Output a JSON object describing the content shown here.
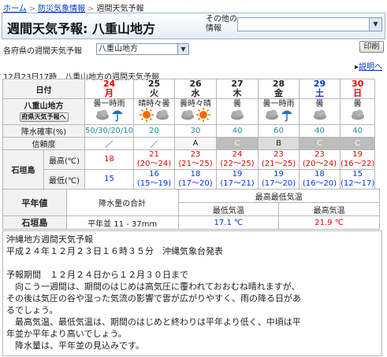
{
  "breadcrumb": [
    "ホーム",
    "防災気象情報",
    "週間天気予報"
  ],
  "header": {
    "title": "週間天気予報: 八重山地方",
    "other_info_label": "その他の情報",
    "other_info_value": ""
  },
  "toolbar": {
    "pref_label": "各府県の週間天気予報",
    "pref_value": "八重山地方",
    "print_label": "印刷",
    "help_label": "説明へ"
  },
  "issue_line": "12月23日17時　八重山地方の週間天気予報",
  "forecast": {
    "row_labels": {
      "date": "日付",
      "region": "八重山地方",
      "region_button": "府県天気予報へ",
      "pop": "降水確率(%)",
      "reliability": "信頼度",
      "city": "石垣島",
      "max": "最高(℃)",
      "min": "最低(℃)"
    },
    "days": [
      {
        "date": "24",
        "dow": "月",
        "weather": "曇一時雨",
        "icons": [
          "cloud-icon",
          "umbrella-icon"
        ],
        "pop": "50/30/20/10",
        "rel": "／",
        "max": "18",
        "max_range": "",
        "min": "15",
        "min_range": "",
        "color": "red"
      },
      {
        "date": "25",
        "dow": "火",
        "weather": "晴時々曇",
        "icons": [
          "sun-icon",
          "cloud-icon"
        ],
        "pop": "20",
        "rel": "／",
        "max": "21",
        "max_range": "(20〜24)",
        "min": "16",
        "min_range": "(15〜19)",
        "color": ""
      },
      {
        "date": "26",
        "dow": "水",
        "weather": "曇時々晴",
        "icons": [
          "cloud-icon",
          "sun-icon"
        ],
        "pop": "30",
        "rel": "A",
        "max": "23",
        "max_range": "(21〜25)",
        "min": "18",
        "min_range": "(17〜20)",
        "color": ""
      },
      {
        "date": "27",
        "dow": "木",
        "weather": "曇",
        "icons": [
          "cloud-icon"
        ],
        "pop": "40",
        "rel": "C",
        "max": "24",
        "max_range": "(22〜25)",
        "min": "19",
        "min_range": "(17〜21)",
        "color": ""
      },
      {
        "date": "28",
        "dow": "金",
        "weather": "曇一時雨",
        "icons": [
          "cloud-icon",
          "umbrella-icon"
        ],
        "pop": "60",
        "rel": "B",
        "max": "23",
        "max_range": "(21〜25)",
        "min": "19",
        "min_range": "(17〜20)",
        "color": ""
      },
      {
        "date": "29",
        "dow": "土",
        "weather": "曇",
        "icons": [
          "cloud-icon"
        ],
        "pop": "40",
        "rel": "C",
        "max": "23",
        "max_range": "(20〜24)",
        "min": "18",
        "min_range": "(16〜20)",
        "color": "blue"
      },
      {
        "date": "30",
        "dow": "日",
        "weather": "曇",
        "icons": [
          "cloud-icon"
        ],
        "pop": "40",
        "rel": "C",
        "max": "19",
        "max_range": "(16〜22)",
        "min": "15",
        "min_range": "(12〜17)",
        "color": "red"
      }
    ]
  },
  "normals": {
    "title": "平年値",
    "precip_header": "降水量の合計",
    "temp_header": "最高最低気温",
    "min_header": "最低気温",
    "max_header": "最高気温",
    "city": "石垣島",
    "precip_value": "平年並 11 - 37mm",
    "min_value": "17.1 ℃",
    "max_value": "21.9 ℃"
  },
  "text": {
    "body": "沖縄地方週間天気予報\n平成２４年１２月２３日１６時３５分　沖縄気象台発表\n\n予報期間　１２月２４日から１２月３０日まで\n　向こう一週間は、期間のはじめは高気圧に覆われておおむね晴れますが、\nその後は気圧の谷や湿った気流の影響で雲が広がりやすく、雨の降る日があ\nるでしょう。\n　最高気温、最低気温は、期間のはじめと終わりは平年より低く、中頃は平\n年並か平年より高いでしょう。\n　降水量は、平年並の見込みです。"
  },
  "colors": {
    "sunday": "#e60000",
    "saturday": "#0033ee",
    "reliability_gray": "#bdbdbd",
    "normal_value": "#0033cc"
  }
}
